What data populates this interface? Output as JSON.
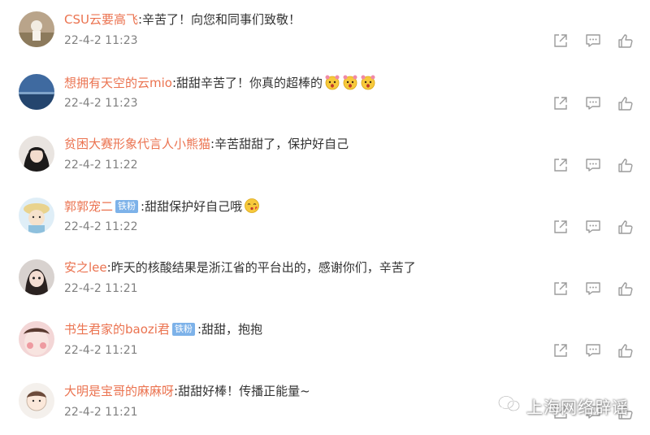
{
  "comments": [
    {
      "username": "CSU云要高飞",
      "text": "辛苦了！向您和同事们致敬！",
      "time": "22-4-2 11:23",
      "badge": "",
      "emoji_count": 0
    },
    {
      "username": "想拥有天空的云mio",
      "text": "甜甜辛苦了！你真的超棒的",
      "time": "22-4-2 11:23",
      "badge": "",
      "emoji_count": 3
    },
    {
      "username": "贫困大赛形象代言人小熊猫",
      "text": "辛苦甜甜了，保护好自己",
      "time": "22-4-2 11:22",
      "badge": "",
      "emoji_count": 0
    },
    {
      "username": "郭郭宠二",
      "text": "甜甜保护好自己哦",
      "time": "22-4-2 11:22",
      "badge": "铁粉",
      "emoji_count": 1
    },
    {
      "username": "安之lee",
      "text": "昨天的核酸结果是浙江省的平台出的，感谢你们，辛苦了",
      "time": "22-4-2 11:21",
      "badge": "",
      "emoji_count": 0
    },
    {
      "username": "书生君家的baozi君",
      "text": "甜甜，抱抱",
      "time": "22-4-2 11:21",
      "badge": "铁粉",
      "emoji_count": 0
    },
    {
      "username": "大明是宝哥的麻麻呀",
      "text": "甜甜好棒！传播正能量~",
      "time": "22-4-2 11:21",
      "badge": "",
      "emoji_count": 0
    }
  ],
  "icons": {
    "share": "share-icon",
    "reply": "comment-icon",
    "like": "thumbs-up-icon"
  },
  "colors": {
    "username": "#eb7350",
    "text": "#333333",
    "time": "#808080",
    "badge": "#7db2e9",
    "icon": "#9b9b9b"
  },
  "watermark": {
    "text": "上海网络辟谣"
  }
}
